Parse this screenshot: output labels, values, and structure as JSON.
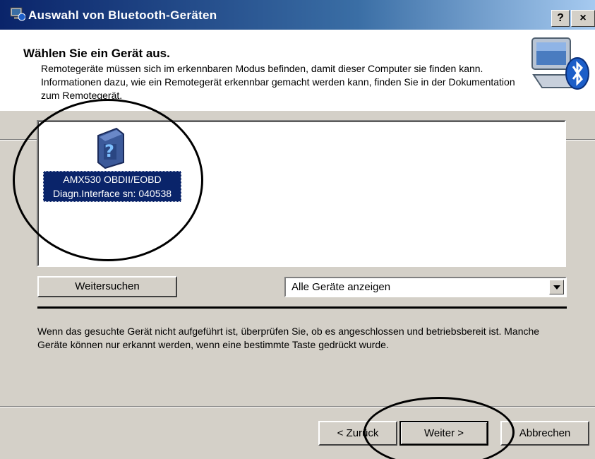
{
  "window": {
    "title": "Auswahl von Bluetooth-Geräten",
    "help_button": "?",
    "close_button": "×"
  },
  "header": {
    "title": "Wählen Sie ein Gerät aus.",
    "description": "Remotegeräte müssen sich im erkennbaren Modus befinden, damit dieser Computer sie finden kann. Informationen dazu, wie ein Remotegerät erkennbar gemacht werden kann, finden Sie in der Dokumentation zum Remotegerät.",
    "icon": "bluetooth-computer-icon"
  },
  "device_list": {
    "items": [
      {
        "label": "AMX530 OBDII/EOBD Diagn.Interface sn: 040538",
        "icon": "unknown-device-icon",
        "selected": true
      }
    ]
  },
  "controls": {
    "search_button": "Weitersuchen",
    "filter": {
      "selected": "Alle Geräte anzeigen"
    }
  },
  "info_text": "Wenn das gesuchte Gerät nicht aufgeführt ist, überprüfen Sie, ob es angeschlossen und betriebsbereit ist. Manche Geräte können nur erkannt werden, wenn eine bestimmte Taste gedrückt wurde.",
  "buttons": {
    "back": "< Zurück",
    "next": "Weiter >",
    "cancel": "Abbrechen"
  },
  "colors": {
    "titlebar_start": "#0a246a",
    "selection": "#0a246a",
    "dialog_face": "#d4d0c8"
  }
}
